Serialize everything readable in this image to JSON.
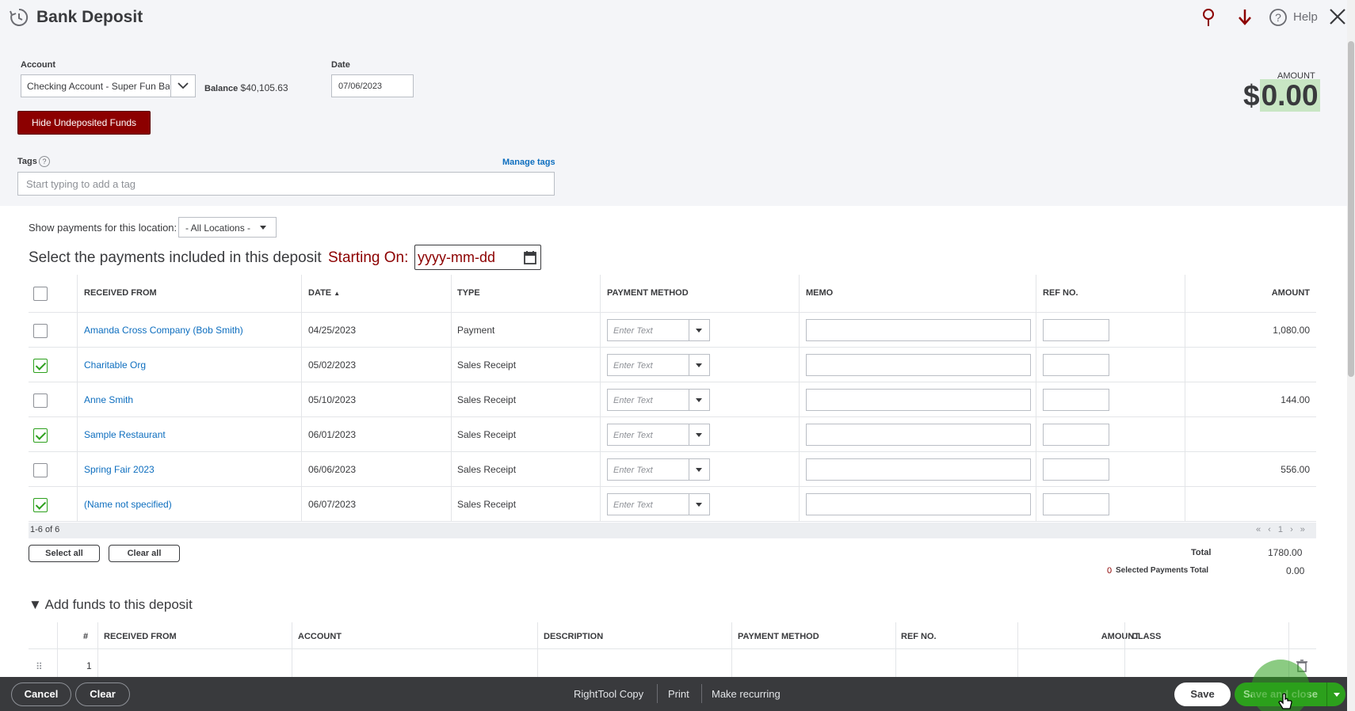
{
  "header": {
    "title": "Bank Deposit",
    "help_label": "Help",
    "account_label": "Account",
    "account_value": "Checking Account - Super Fun Ba",
    "balance_label": "Balance",
    "balance_value": "$40,105.63",
    "date_label": "Date",
    "date_value": "07/06/2023",
    "amount_label": "AMOUNT",
    "amount_currency": "$",
    "amount_value": "0.00",
    "hide_undeposited_label": "Hide Undeposited Funds",
    "tags_label": "Tags",
    "tags_help": "?",
    "manage_tags_label": "Manage tags",
    "tags_placeholder": "Start typing to add a tag"
  },
  "payments": {
    "show_for_location_label": "Show payments for this location:",
    "location_value": "- All Locations -",
    "heading": "Select the payments included in this deposit",
    "starting_on_label": "Starting On:",
    "starting_on_placeholder": "yyyy-mm-dd",
    "columns": {
      "received_from": "RECEIVED FROM",
      "date": "DATE",
      "sort_indicator": "▲",
      "type": "TYPE",
      "payment_method": "PAYMENT METHOD",
      "memo": "MEMO",
      "ref_no": "REF NO.",
      "amount": "AMOUNT"
    },
    "payment_method_placeholder": "Enter Text",
    "rows": [
      {
        "checked": false,
        "received_from": "Amanda Cross Company (Bob Smith)",
        "date": "04/25/2023",
        "type": "Payment",
        "amount": "1,080.00"
      },
      {
        "checked": true,
        "received_from": "Charitable Org",
        "date": "05/02/2023",
        "type": "Sales Receipt",
        "amount": ""
      },
      {
        "checked": false,
        "received_from": "Anne Smith",
        "date": "05/10/2023",
        "type": "Sales Receipt",
        "amount": "144.00"
      },
      {
        "checked": true,
        "received_from": "Sample Restaurant",
        "date": "06/01/2023",
        "type": "Sales Receipt",
        "amount": ""
      },
      {
        "checked": false,
        "received_from": "Spring Fair 2023",
        "date": "06/06/2023",
        "type": "Sales Receipt",
        "amount": "556.00"
      },
      {
        "checked": true,
        "received_from": "(Name not specified)",
        "date": "06/07/2023",
        "type": "Sales Receipt",
        "amount": ""
      }
    ],
    "pager_range": "1-6 of 6",
    "pager_nav": "« ‹ 1 › »",
    "select_all_label": "Select all",
    "clear_all_label": "Clear all",
    "total_label": "Total",
    "total_value": "1780.00",
    "selected_count": "0",
    "selected_total_label": "Selected Payments Total",
    "selected_total_value": "0.00"
  },
  "add_funds": {
    "toggle_label": "▼  Add funds to this deposit",
    "columns": {
      "num": "#",
      "received_from": "RECEIVED FROM",
      "account": "ACCOUNT",
      "description": "DESCRIPTION",
      "payment_method": "PAYMENT METHOD",
      "ref_no": "REF NO.",
      "amount": "AMOUNT",
      "class": "CLASS"
    },
    "rows": [
      {
        "num": "1"
      }
    ]
  },
  "footer": {
    "cancel_label": "Cancel",
    "clear_label": "Clear",
    "righttool_copy_label": "RightTool Copy",
    "print_label": "Print",
    "make_recurring_label": "Make recurring",
    "save_label": "Save",
    "save_close_label": "Save and close"
  },
  "colors": {
    "brand_green": "#2ca01c",
    "danger_red": "#8c0000",
    "link_blue": "#0d6ebf",
    "footer_bg": "#393a3d"
  },
  "icons": [
    "history-icon",
    "pin-icon",
    "download-icon",
    "help-icon",
    "close-icon",
    "chevron-down-icon",
    "calendar-icon",
    "drag-handle-icon",
    "trash-icon",
    "cursor-hand-icon"
  ]
}
